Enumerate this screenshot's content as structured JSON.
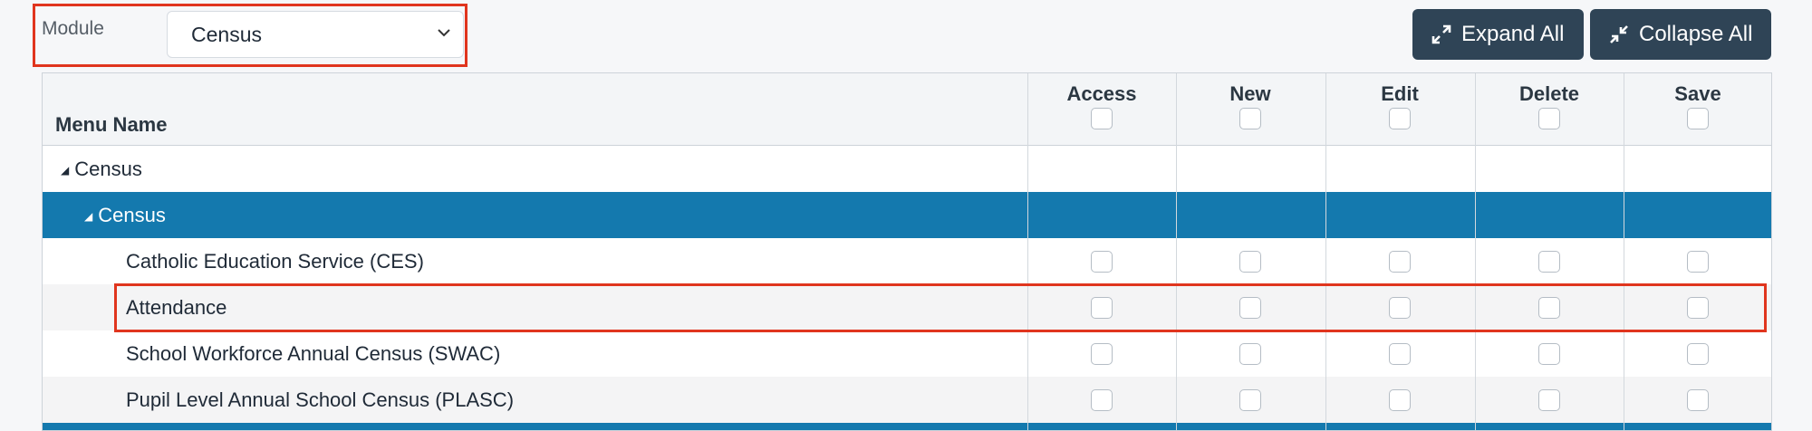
{
  "module": {
    "label": "Module",
    "selected": "Census"
  },
  "toolbar": {
    "expand_label": "Expand All",
    "collapse_label": "Collapse All"
  },
  "grid": {
    "menu_header": "Menu Name",
    "columns": [
      "Access",
      "New",
      "Edit",
      "Delete",
      "Save"
    ],
    "groups": [
      {
        "label": "Census"
      },
      {
        "label": "Census"
      }
    ],
    "items": [
      {
        "label": "Catholic Education Service (CES)"
      },
      {
        "label": "Attendance"
      },
      {
        "label": "School Workforce Annual Census (SWAC)"
      },
      {
        "label": "Pupil Level Annual School Census (PLASC)"
      }
    ]
  },
  "colors": {
    "accent": "#1479ae",
    "button": "#2f4456",
    "highlight": "#e0351e"
  }
}
